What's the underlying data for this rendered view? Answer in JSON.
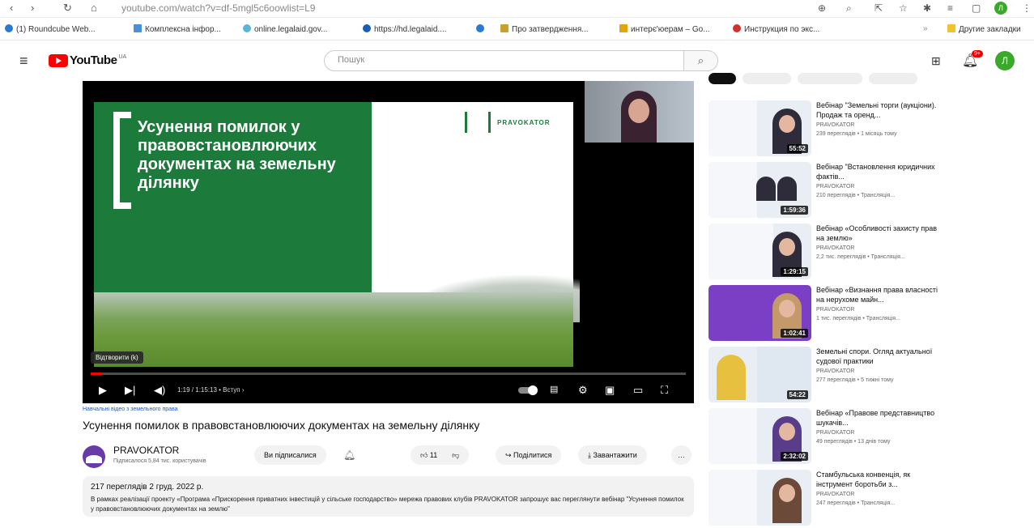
{
  "browser": {
    "url": "youtube.com/watch?v=df-5mgl5c6oowlist=L9",
    "bookmarks": [
      {
        "label": "(1) Roundcube Web...",
        "color": "#2a7ad1"
      },
      {
        "label": "Комплексна інфор...",
        "color": "#4a90d9"
      },
      {
        "label": "online.legalaid.gov...",
        "color": "#5bb5d6"
      },
      {
        "label": "https://hd.legalaid....",
        "color": "#1a5fb4"
      },
      {
        "label": "",
        "color": "#2a7ad1"
      },
      {
        "label": "Про затвердження...",
        "color": "#c8a02a"
      },
      {
        "label": "интерє'юерам – Go...",
        "color": "#e4a40d"
      },
      {
        "label": "Инструкция по экс...",
        "color": "#d32f2f"
      }
    ],
    "other_bookmarks": "Другие закладки"
  },
  "youtube": {
    "logo_text": "YouTube",
    "country_code": "UA",
    "search_placeholder": "Пошук",
    "notifications_badge": "9+",
    "avatar_letter": "Л"
  },
  "player": {
    "slide_title": "Усунення помилок у правовстановлюючих документах на земельну ділянку",
    "slide_logo": "PRAVOKATOR",
    "tooltip": "Відтворити (k)",
    "time": "1:19 / 1:15:13 • Вступ ›",
    "progress_fraction": 0.018
  },
  "video": {
    "hashtags": "Навчальні відео з земельного права",
    "title": "Усунення помилок в правовстановлюючих документах на земельну ділянку",
    "channel_name": "PRAVOKATOR",
    "subscribers": "Підписалося 5,84 тис. користувачів",
    "subscribed_label": "Ви підписалися",
    "likes": "11",
    "share_label": "Поділитися",
    "download_label": "Завантажити",
    "more_label": "…",
    "views_date": "217 переглядів  2 груд. 2022 р.",
    "description": "В рамках реалізації проекту «Програма «Прискорення приватних інвестицій у сільське господарство» мережа правових клубів PRAVOKATOR запрошує вас переглянути вебінар \"Усунення помилок у правовстановлюючих документах на землю\""
  },
  "recommendations": [
    {
      "title": "Вебінар \"Земельні торги (аукціони). Продаж та оренд...",
      "channel": "PRAVOKATOR",
      "meta": "239 переглядів • 1 місяць тому",
      "duration": "55:52",
      "style": "light"
    },
    {
      "title": "Вебінар \"Встановлення юридичних фактів...",
      "channel": "PRAVOKATOR",
      "meta": "210 переглядів • Трансляція...",
      "duration": "1:59:36",
      "style": "light"
    },
    {
      "title": "Вебінар «Особливості захисту прав на землю»",
      "channel": "PRAVOKATOR",
      "meta": "2,2 тис. переглядів • Трансляція...",
      "duration": "1:29:15",
      "style": "light"
    },
    {
      "title": "Вебінар «Визнання права власності на нерухоме майн...",
      "channel": "PRAVOKATOR",
      "meta": "1 тис. переглядів • Трансляція...",
      "duration": "1:02:41",
      "style": "purple"
    },
    {
      "title": "Земельні спори. Огляд актуальної судової практики",
      "channel": "PRAVOKATOR",
      "meta": "277 переглядів • 5 тижні тому",
      "duration": "54:22",
      "style": "light"
    },
    {
      "title": "Вебінар «Правове представництво шукачів...",
      "channel": "PRAVOKATOR",
      "meta": "49 переглядів • 13 днів тому",
      "duration": "2:32:02",
      "style": "light"
    },
    {
      "title": "Стамбульська конвенція, як інструмент боротьби з...",
      "channel": "PRAVOKATOR",
      "meta": "247 переглядів • Трансляція...",
      "duration": "",
      "style": "light"
    }
  ]
}
